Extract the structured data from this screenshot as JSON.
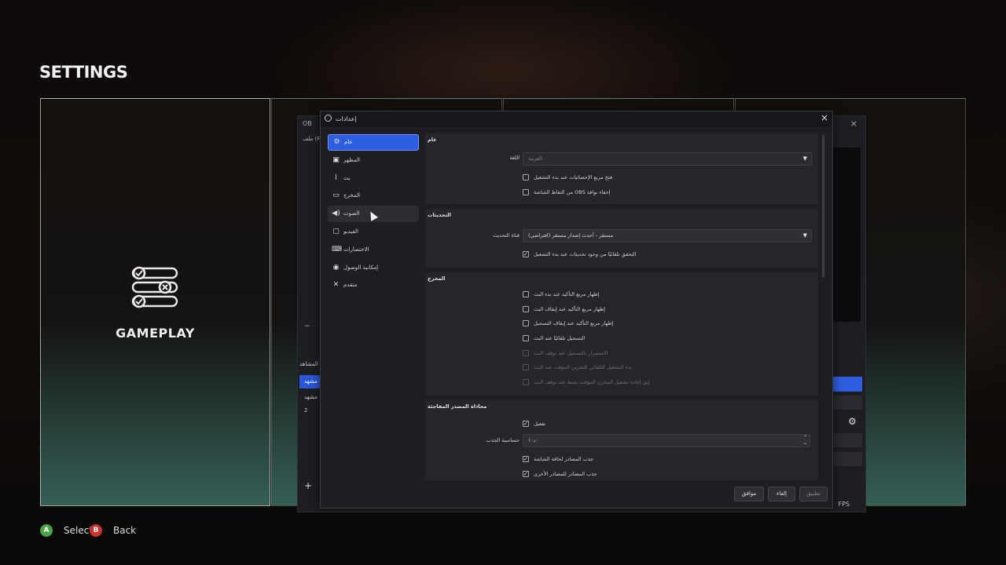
{
  "game": {
    "title": "SETTINGS",
    "gameplay_label": "GAMEPLAY",
    "hints": [
      {
        "button": "A",
        "label": "Select",
        "color": "#4aa34a"
      },
      {
        "button": "B",
        "label": "Back",
        "color": "#c8322f"
      }
    ]
  },
  "obs_main": {
    "title": "OB",
    "menu": "ملف (F)",
    "scenes_header": "المشاهد",
    "scenes": [
      "مشهد",
      "مشهد 2"
    ],
    "fps": "FPS",
    "add": "+",
    "minus": "−"
  },
  "dialog": {
    "title": "إعدادات",
    "close": "×",
    "nav": [
      {
        "label": "عام",
        "icon": "gear-icon"
      },
      {
        "label": "المظهر",
        "icon": "appearance-icon"
      },
      {
        "label": "بث",
        "icon": "antenna-icon"
      },
      {
        "label": "المخرج",
        "icon": "output-icon"
      },
      {
        "label": "الصوت",
        "icon": "speaker-icon"
      },
      {
        "label": "الفيديو",
        "icon": "monitor-icon"
      },
      {
        "label": "الاختصارات",
        "icon": "keyboard-icon"
      },
      {
        "label": "إمكانية الوصول",
        "icon": "accessibility-icon"
      },
      {
        "label": "متقدم",
        "icon": "tools-icon"
      }
    ],
    "general": {
      "title": "عام",
      "language_label": "اللغة",
      "language_value": "العربية",
      "checks": [
        {
          "label": "فتح مربع الإحصائيات عند بدء التشغيل",
          "checked": false
        },
        {
          "label": "من التقاط الشاشة OBS إخفاء نوافذ",
          "checked": false
        }
      ]
    },
    "updates": {
      "title": "التحديثات",
      "channel_label": "قناة التحديث",
      "channel_value": "مستقر - أحدث إصدار مستقر (افتراضي)",
      "check_label": "التحقق تلقائيًا من وجود تحديثات عند بدء التشغيل",
      "checked": true
    },
    "output": {
      "title": "المخرج",
      "checks": [
        {
          "label": "إظهار مربع التأكيد عند بدء البث",
          "checked": false,
          "disabled": false
        },
        {
          "label": "إظهار مربع التأكيد عند إيقاف البث",
          "checked": false,
          "disabled": false
        },
        {
          "label": "إظهار مربع التأكيد عند إيقاف التسجيل",
          "checked": false,
          "disabled": false
        },
        {
          "label": "التسجيل تلقائيًا عند البث",
          "checked": false,
          "disabled": false
        },
        {
          "label": "الاستمرار بالتسجيل عند توقف البث",
          "checked": false,
          "disabled": true
        },
        {
          "label": "بدء التشغيل التلقائي للتخزين المؤقت عند البث",
          "checked": false,
          "disabled": true
        },
        {
          "label": "إبق إعادة تشغيل المخزن المؤقت نشط عند توقف البث",
          "checked": false,
          "disabled": true
        }
      ]
    },
    "snapping": {
      "title": "محاذاة المصدر المفاجئة",
      "enable_label": "تفعيل",
      "enable_checked": true,
      "sensitivity_label": "حساسية الجذب",
      "sensitivity_value": "١٠٫٠",
      "checks": [
        {
          "label": "جذب المصادر لحافة الشاشة",
          "checked": true
        },
        {
          "label": "جذب المصادر للمصادر الأخرى",
          "checked": true
        }
      ]
    },
    "buttons": {
      "ok": "موافق",
      "cancel": "إلغاء",
      "apply": "تطبيق"
    }
  },
  "colors": {
    "accent": "#2d5ee0",
    "dialog_bg": "#1d1e22",
    "group_bg": "#25262b"
  }
}
